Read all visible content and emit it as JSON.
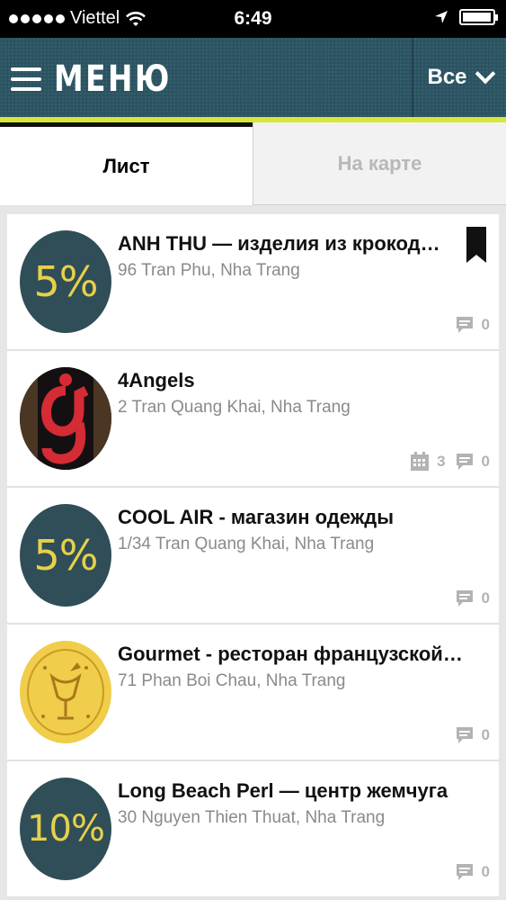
{
  "status_bar": {
    "carrier": "Viettel",
    "time": "6:49"
  },
  "header": {
    "menu_label": "МЕНЮ",
    "filter_label": "Все"
  },
  "tabs": [
    {
      "label": "Лист",
      "active": true
    },
    {
      "label": "На карте",
      "active": false
    }
  ],
  "colors": {
    "header_bg": "#2b5361",
    "accent": "#d8e63a",
    "discount_badge_bg": "#2f4e58",
    "discount_text": "#e7d14a"
  },
  "places": [
    {
      "title": "ANH THU — изделия из крокод…",
      "address": "96 Tran Phu, Nha Trang",
      "avatar": {
        "kind": "discount",
        "text": "5%"
      },
      "bookmarked": true,
      "events": null,
      "comments": "0"
    },
    {
      "title": "4Angels",
      "address": "2 Tran Quang Khai, Nha Trang",
      "avatar": {
        "kind": "logo",
        "icon": "4angels-logo"
      },
      "bookmarked": false,
      "events": "3",
      "comments": "0"
    },
    {
      "title": "COOL AIR - магазин одежды",
      "address": "1/34 Tran Quang Khai, Nha Trang",
      "avatar": {
        "kind": "discount",
        "text": "5%"
      },
      "bookmarked": false,
      "events": null,
      "comments": "0"
    },
    {
      "title": "Gourmet - ресторан французской …",
      "address": "71 Phan Boi Chau, Nha Trang",
      "avatar": {
        "kind": "logo",
        "icon": "gourmet-logo"
      },
      "bookmarked": false,
      "events": null,
      "comments": "0"
    },
    {
      "title": "Long Beach Perl — центр жемчуга",
      "address": "30 Nguyen Thien Thuat, Nha Trang",
      "avatar": {
        "kind": "discount",
        "text": "10%"
      },
      "bookmarked": false,
      "events": null,
      "comments": "0"
    }
  ]
}
